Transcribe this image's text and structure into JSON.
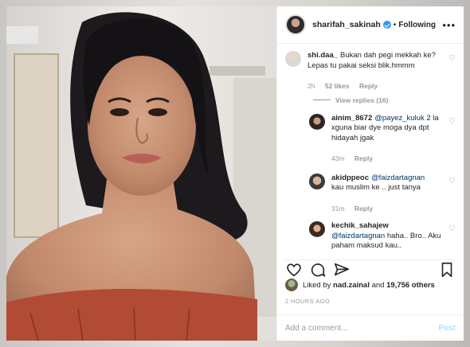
{
  "post": {
    "username": "sharifah_sakinah",
    "follow_status": "Following",
    "dot": "•"
  },
  "icons": {
    "more": "more-dots-icon",
    "heart": "heart-icon",
    "comment": "comment-icon",
    "share": "share-icon",
    "bookmark": "bookmark-icon"
  },
  "comments": [
    {
      "user": "shi.daa_",
      "text": "Bukan dah pegi mekkah ke? Lepas tu pakai seksi blik.hmmm",
      "time": "2h",
      "likes": "52 likes",
      "reply_label": "Reply",
      "view_replies": "View replies (16)"
    },
    {
      "user": "ainim_8672",
      "mention": "@payez_kuluk",
      "text": "2 la xguna biar dye moga dya dpt hidayah jgak",
      "time": "43m",
      "reply_label": "Reply"
    },
    {
      "user": "akidppeoc",
      "mention": "@faizdartagnan",
      "text": "kau muslim ke .. just tanya",
      "time": "31m",
      "reply_label": "Reply"
    },
    {
      "user": "kechik_sahajew",
      "mention": "@faizdartagnan",
      "text": "haha.. Bro.. Aku paham maksud kau.."
    }
  ],
  "likes": {
    "prefix": "Liked by",
    "user": "nad.zainal",
    "connector": "and",
    "count": "19,756 others"
  },
  "timestamp": "2 HOURS AGO",
  "add_comment": {
    "placeholder": "Add a comment...",
    "post_label": "Post"
  },
  "colors": {
    "verified": "#3897f0",
    "mention": "#003569",
    "post_disabled": "#b2dffc"
  }
}
